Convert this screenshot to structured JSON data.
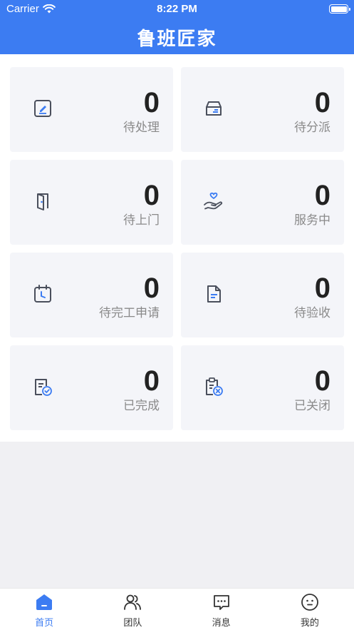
{
  "status_bar": {
    "carrier": "Carrier",
    "time": "8:22 PM"
  },
  "header": {
    "title": "鲁班匠家"
  },
  "cards": [
    {
      "count": "0",
      "label": "待处理",
      "icon": "edit-icon"
    },
    {
      "count": "0",
      "label": "待分派",
      "icon": "inbox-icon"
    },
    {
      "count": "0",
      "label": "待上门",
      "icon": "door-icon"
    },
    {
      "count": "0",
      "label": "服务中",
      "icon": "hand-heart-icon"
    },
    {
      "count": "0",
      "label": "待完工申请",
      "icon": "calendar-clock-icon"
    },
    {
      "count": "0",
      "label": "待验收",
      "icon": "document-icon"
    },
    {
      "count": "0",
      "label": "已完成",
      "icon": "document-check-icon"
    },
    {
      "count": "0",
      "label": "已关闭",
      "icon": "clipboard-x-icon"
    }
  ],
  "tabbar": {
    "items": [
      {
        "label": "首页",
        "icon": "home-icon",
        "active": true
      },
      {
        "label": "团队",
        "icon": "team-icon",
        "active": false
      },
      {
        "label": "消息",
        "icon": "message-icon",
        "active": false
      },
      {
        "label": "我的",
        "icon": "profile-icon",
        "active": false
      }
    ]
  },
  "colors": {
    "brand": "#3c7cf2",
    "card_bg": "#f4f5f9",
    "icon_stroke": "#4a4f5c"
  }
}
